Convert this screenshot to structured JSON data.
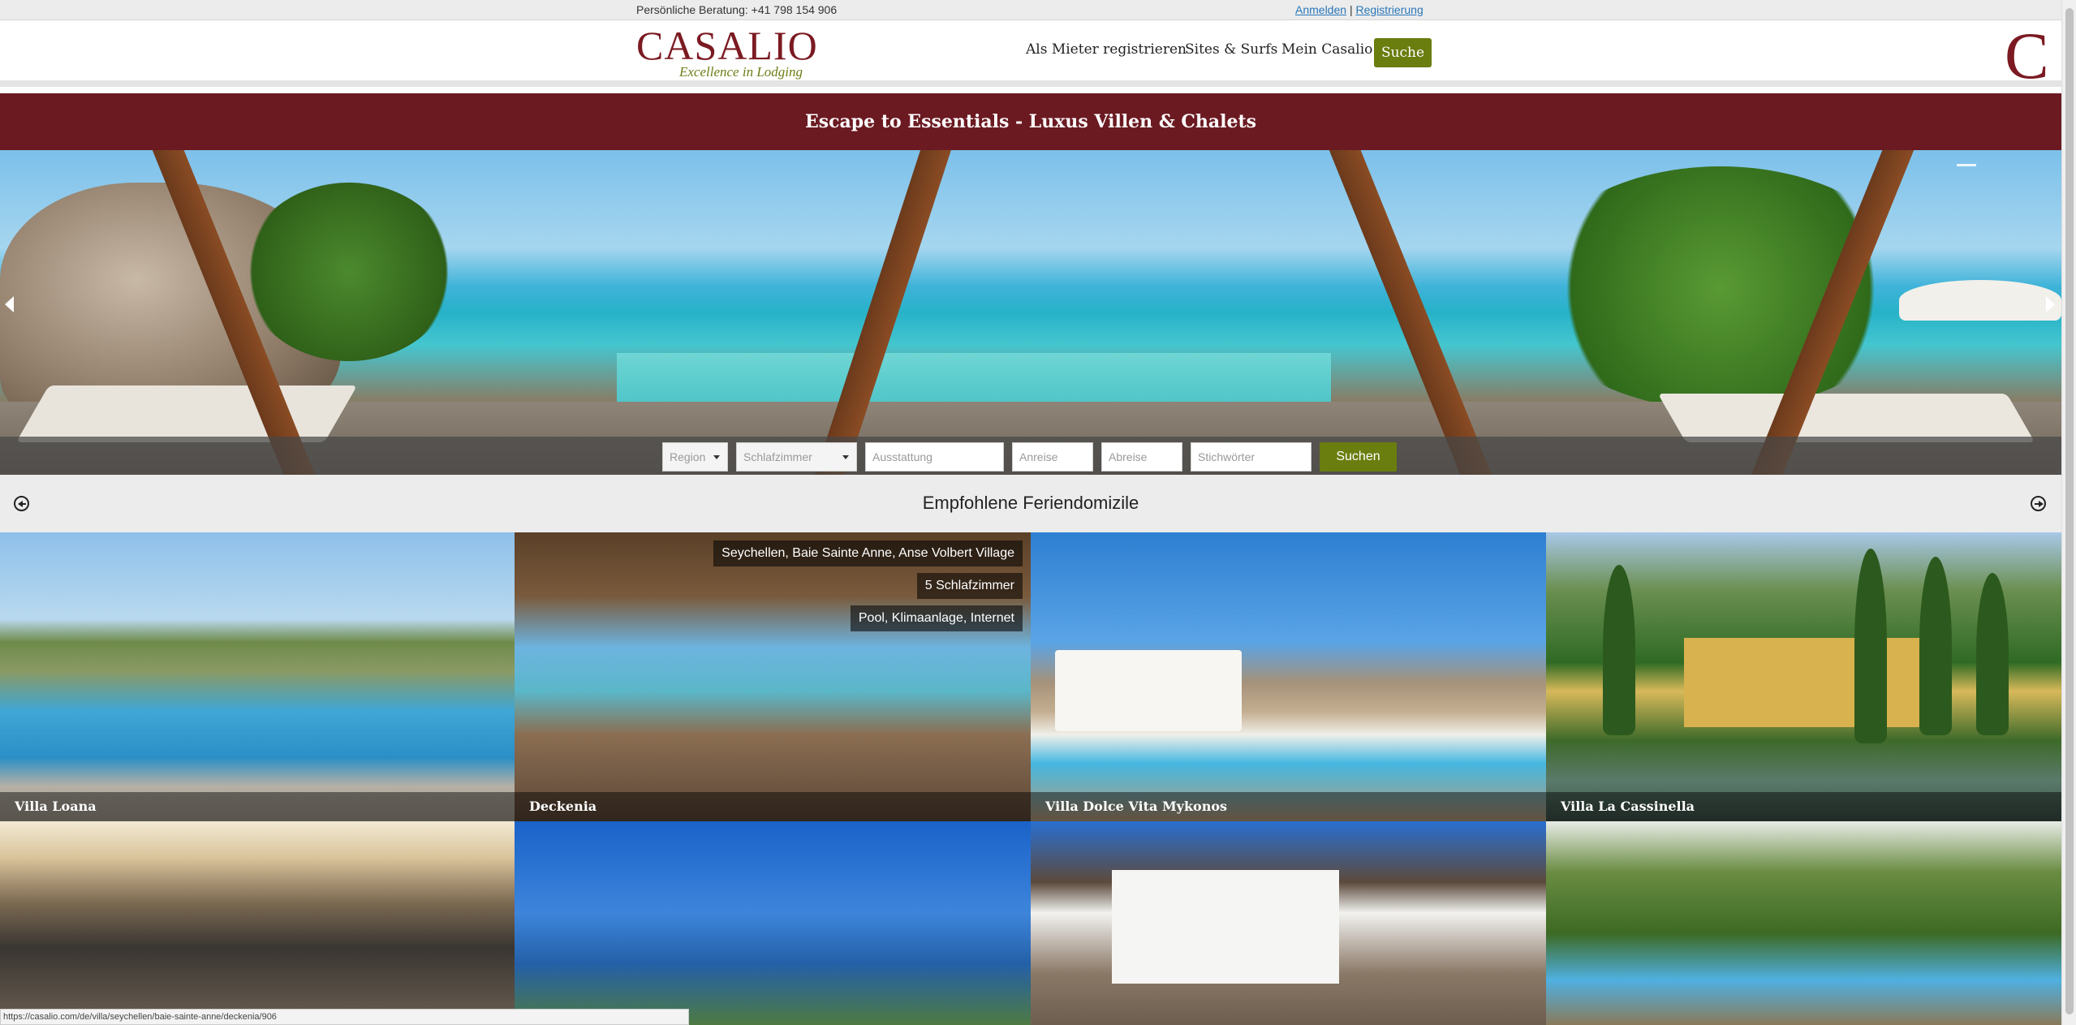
{
  "topbar": {
    "phone": "Persönliche Beratung: +41 798 154 906",
    "login": "Anmelden",
    "separator": "|",
    "register": "Registrierung"
  },
  "header": {
    "logo": "CASALIO",
    "tagline": "Excellence in Lodging",
    "nav": [
      "Als Mieter registrieren",
      "Sites & Surfs",
      "Mein Casalio"
    ],
    "search": "Suche",
    "side_logo": "C"
  },
  "banner": "Escape to Essentials - Luxus Villen & Chalets",
  "search": {
    "region": "Region",
    "rooms": "Schlafzimmer",
    "equipment": "Ausstattung",
    "arrival": "Anreise",
    "departure": "Abreise",
    "keywords": "Stichwörter",
    "submit": "Suchen"
  },
  "featured": {
    "title": "Empfohlene Feriendomizile",
    "villas": [
      {
        "name": "Villa Loana"
      },
      {
        "name": "Deckenia",
        "location": "Seychellen, Baie Sainte Anne, Anse Volbert Village",
        "rooms": "5 Schlafzimmer",
        "amenities": "Pool, Klimaanlage, Internet"
      },
      {
        "name": "Villa Dolce Vita Mykonos"
      },
      {
        "name": "Villa La Cassinella"
      }
    ]
  },
  "status_url": "https://casalio.com/de/villa/seychellen/baie-sainte-anne/deckenia/906",
  "colors": {
    "brand": "#7b1a22",
    "accent": "#6a7d0f",
    "banner": "#6b1a22"
  },
  "icons": {
    "prev": "circle-arrow-left-icon",
    "next": "circle-arrow-right-icon"
  }
}
